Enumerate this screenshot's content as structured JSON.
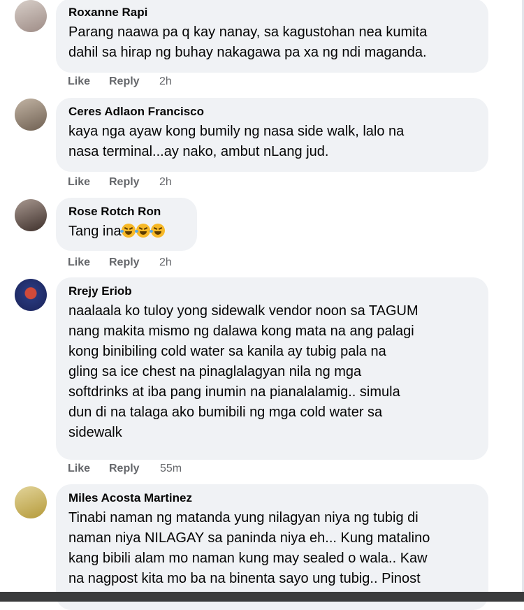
{
  "comments": [
    {
      "author": "Roxanne Rapi",
      "text": "Parang naawa pa q kay nanay, sa kagustohan nea kumita\ndahil sa hirap ng buhay nakagawa pa xa ng ndi maganda.",
      "like": "Like",
      "reply": "Reply",
      "time": "2h",
      "avatar_color": "#b9a9a3"
    },
    {
      "author": "Ceres Adlaon Francisco",
      "text": "kaya nga ayaw kong bumily ng nasa side walk, lalo na\nnasa terminal...ay nako, ambut nLang jud.",
      "like": "Like",
      "reply": "Reply",
      "time": "2h",
      "avatar_color": "#8a7b6c"
    },
    {
      "author": "Rose Rotch Ron",
      "text": "Tang ina",
      "emoji_count": 3,
      "like": "Like",
      "reply": "Reply",
      "time": "2h",
      "avatar_color": "#5b4a44"
    },
    {
      "author": "Rrejy Eriob",
      "text": "naalaala ko tuloy yong sidewalk vendor noon sa TAGUM\nnang makita mismo ng dalawa kong mata na ang palagi\nkong binibiling cold water sa kanila ay tubig pala na\ngling sa ice chest na pinaglalagyan nila ng mga\nsoftdrinks at iba pang inumin na pianalalamig.. simula\ndun di na talaga ako bumibili ng mga cold water sa\nsidewalk",
      "like": "Like",
      "reply": "Reply",
      "time": "55m",
      "avatar_color": "#2b3f8c"
    },
    {
      "author": "Miles Acosta Martinez",
      "text": "Tinabi naman ng matanda yung nilagyan niya ng tubig di\nnaman niya NILAGAY sa paninda niya eh... Kung matalino\nkang bibili alam mo naman kung may sealed o wala.. Kaw\nna nagpost kita mo ba na binenta sayo ung tubig.. Pinost",
      "avatar_color": "#c9b24a"
    }
  ]
}
